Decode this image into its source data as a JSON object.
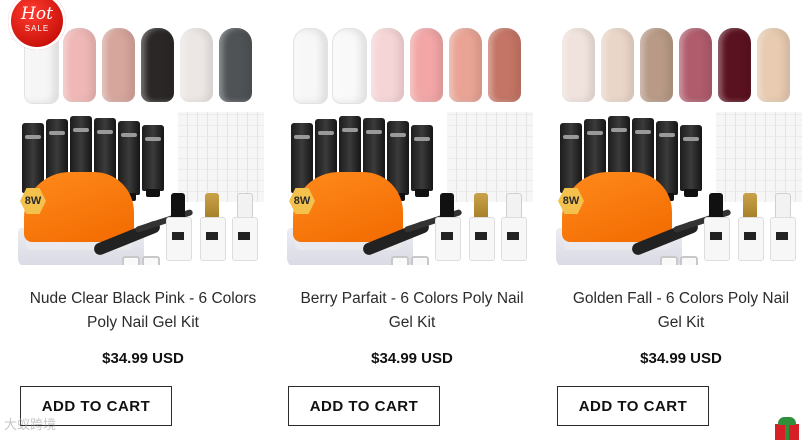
{
  "products": [
    {
      "title_line1": "Nude Clear Black Pink - 6 Colors",
      "title_line2": "Poly Nail Gel Kit",
      "price": "$34.99 USD",
      "button_label": "ADD TO CART",
      "lamp_badge": "8W",
      "swatches": [
        "#f6f6f6",
        "#efb8b6",
        "#d6a59c",
        "#2a2726",
        "#ece7e4",
        "#4f5356"
      ]
    },
    {
      "title_line1": "Berry Parfait - 6 Colors Poly Nail",
      "title_line2": "Gel Kit",
      "price": "$34.99 USD",
      "button_label": "ADD TO CART",
      "lamp_badge": "8W",
      "swatches": [
        "#f7f7f7",
        "#f9f9f9",
        "#f6d5d6",
        "#f2a6a6",
        "#e9a495",
        "#c47565"
      ]
    },
    {
      "title_line1": "Golden Fall - 6 Colors Poly Nail",
      "title_line2": "Gel Kit",
      "price": "$34.99 USD",
      "button_label": "ADD TO CART",
      "lamp_badge": "8W",
      "swatches": [
        "#f0e2dc",
        "#ead6c8",
        "#b89a86",
        "#b05c6d",
        "#5b1220",
        "#e8cbb0"
      ]
    }
  ],
  "hot_badge": {
    "line1": "Hot",
    "line2": "SALE"
  },
  "watermark": "大蚁跨境",
  "colors": {
    "lamp": "#f26a00",
    "hot_badge": "#d3150d",
    "button_border": "#2b2b2b"
  }
}
